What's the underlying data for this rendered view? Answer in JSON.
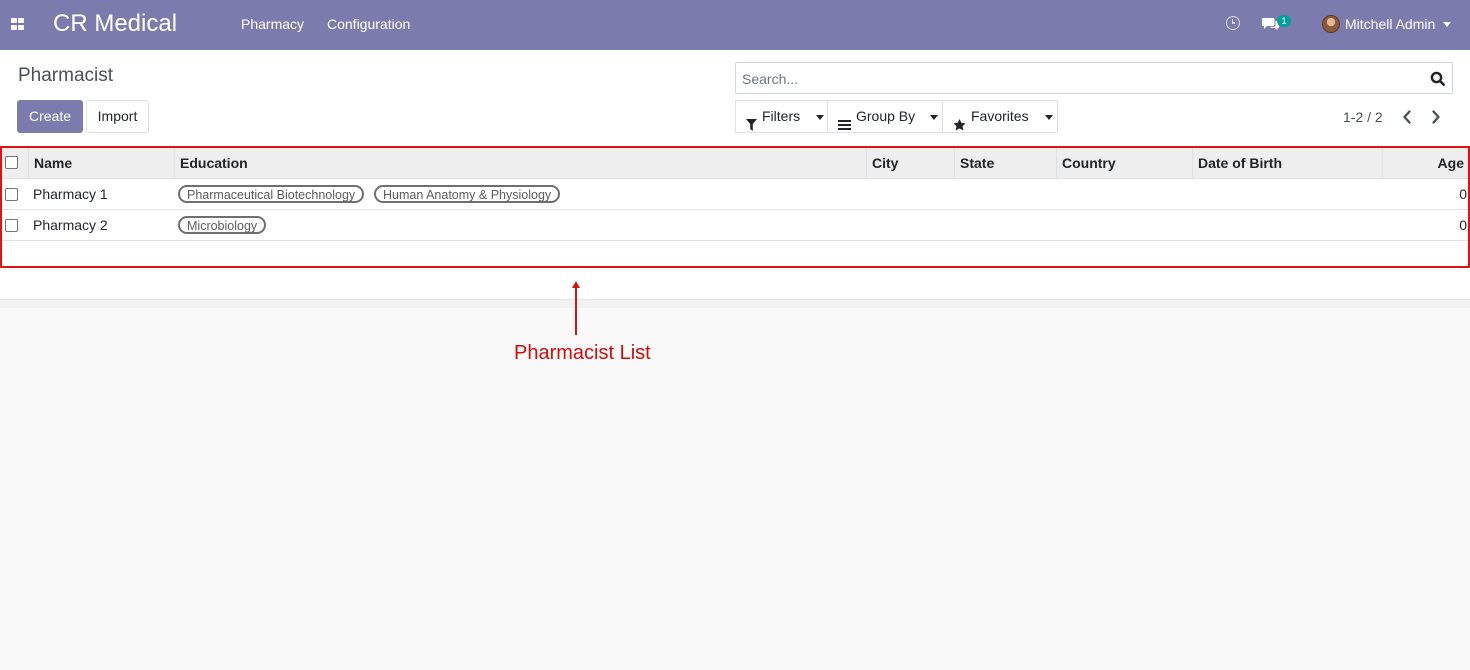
{
  "navbar": {
    "brand": "CR Medical",
    "menu": [
      "Pharmacy",
      "Configuration"
    ],
    "messages_count": "1",
    "user_name": "Mitchell Admin",
    "bg_color": "#7c7bad"
  },
  "control_panel": {
    "title": "Pharmacist",
    "create_label": "Create",
    "import_label": "Import",
    "search_placeholder": "Search...",
    "filters_label": "Filters",
    "groupby_label": "Group By",
    "favorites_label": "Favorites",
    "pager": "1-2 / 2"
  },
  "table": {
    "columns": [
      "Name",
      "Education",
      "City",
      "State",
      "Country",
      "Date of Birth",
      "Age"
    ],
    "rows": [
      {
        "name": "Pharmacy 1",
        "education": [
          "Pharmaceutical Biotechnology",
          "Human Anatomy & Physiology"
        ],
        "city": "",
        "state": "",
        "country": "",
        "dob": "",
        "age": "0"
      },
      {
        "name": "Pharmacy 2",
        "education": [
          "Microbiology"
        ],
        "city": "",
        "state": "",
        "country": "",
        "dob": "",
        "age": "0"
      }
    ]
  },
  "annotation": {
    "label": "Pharmacist List",
    "color": "#e01212"
  },
  "icons": [
    "apps-icon",
    "clock-icon",
    "chat-icon",
    "avatar",
    "search-icon",
    "filter-icon",
    "groupby-icon",
    "star-icon",
    "chevron-left-icon",
    "chevron-right-icon"
  ]
}
